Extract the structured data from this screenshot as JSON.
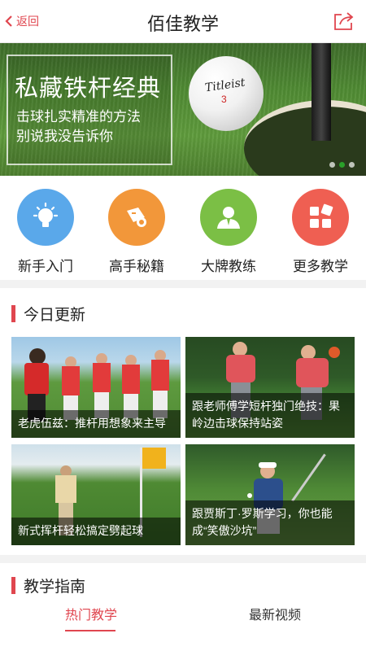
{
  "topbar": {
    "back_label": "返回",
    "title": "佰佳教学",
    "share_icon": "share-icon"
  },
  "banner": {
    "headline": "私藏铁杆经典",
    "subline1": "击球扎实精准的方法",
    "subline2": "别说我没告诉你",
    "ball_brand": "Titleist",
    "ball_number": "3",
    "slide_count": 3,
    "active_slide": 1
  },
  "categories": [
    {
      "label": "新手入门",
      "icon": "lightbulb-icon",
      "color": "#5aa8ea"
    },
    {
      "label": "高手秘籍",
      "icon": "secret-book-icon",
      "color": "#f2973a"
    },
    {
      "label": "大牌教练",
      "icon": "coach-icon",
      "color": "#7bbf45"
    },
    {
      "label": "更多教学",
      "icon": "grid-more-icon",
      "color": "#ef5f52"
    }
  ],
  "today": {
    "title": "今日更新",
    "cards": [
      {
        "caption": "老虎伍兹：推杆用想象来主导"
      },
      {
        "caption": "跟老师傅学短杆独门绝技：果岭边击球保持站姿"
      },
      {
        "caption": "新式挥杆轻松搞定劈起球"
      },
      {
        "caption": "跟贾斯丁·罗斯学习，你也能成“笑傲沙坑”"
      }
    ]
  },
  "guide": {
    "title": "教学指南",
    "tabs": [
      {
        "label": "热门教学"
      },
      {
        "label": "最新视频"
      }
    ],
    "active_tab": 0
  },
  "colors": {
    "accent": "#e0464f"
  }
}
